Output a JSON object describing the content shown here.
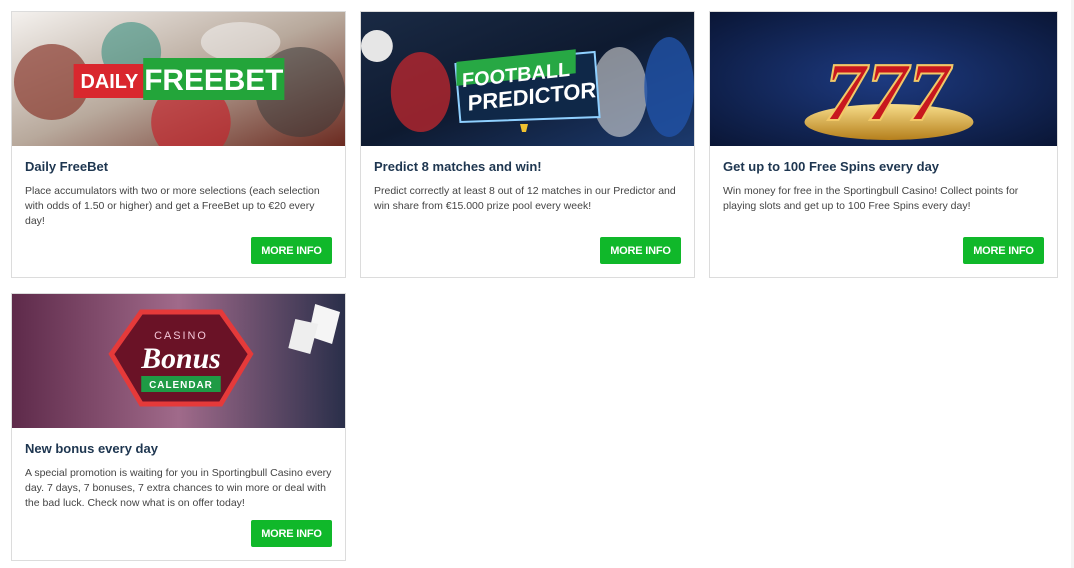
{
  "promotions": [
    {
      "banner": {
        "badge_left": "DAILY",
        "badge_right": "FREEBET"
      },
      "title": "Daily FreeBet",
      "text": "Place accumulators with two or more selections (each selection with odds of 1.50 or higher) and get a FreeBet up to €20 every day!",
      "button": "MORE INFO"
    },
    {
      "banner": {
        "line1": "FOOTBALL",
        "line2": "PREDICTOR"
      },
      "title": "Predict 8 matches and win!",
      "text": "Predict correctly at least 8 out of 12 matches in our Predictor and win share from €15.000 prize pool every week!",
      "button": "MORE INFO"
    },
    {
      "banner": {
        "digits": "777"
      },
      "title": "Get up to 100 Free Spins every day",
      "text": "Win money for free in the Sportingbull Casino! Collect points for playing slots and get up to 100 Free Spins every day!",
      "button": "MORE INFO"
    },
    {
      "banner": {
        "top": "CASINO",
        "main": "Bonus",
        "ribbon": "CALENDAR"
      },
      "title": "New bonus every day",
      "text": "A special promotion is waiting for you in Sportingbull Casino every day. 7 days, 7 bonuses, 7 extra chances to win more or deal with the bad luck. Check now what is on offer today!",
      "button": "MORE INFO"
    }
  ],
  "colors": {
    "button": "#10b82a",
    "title": "#1e3650",
    "badge_red": "#d9272e",
    "badge_green": "#23a53a"
  }
}
